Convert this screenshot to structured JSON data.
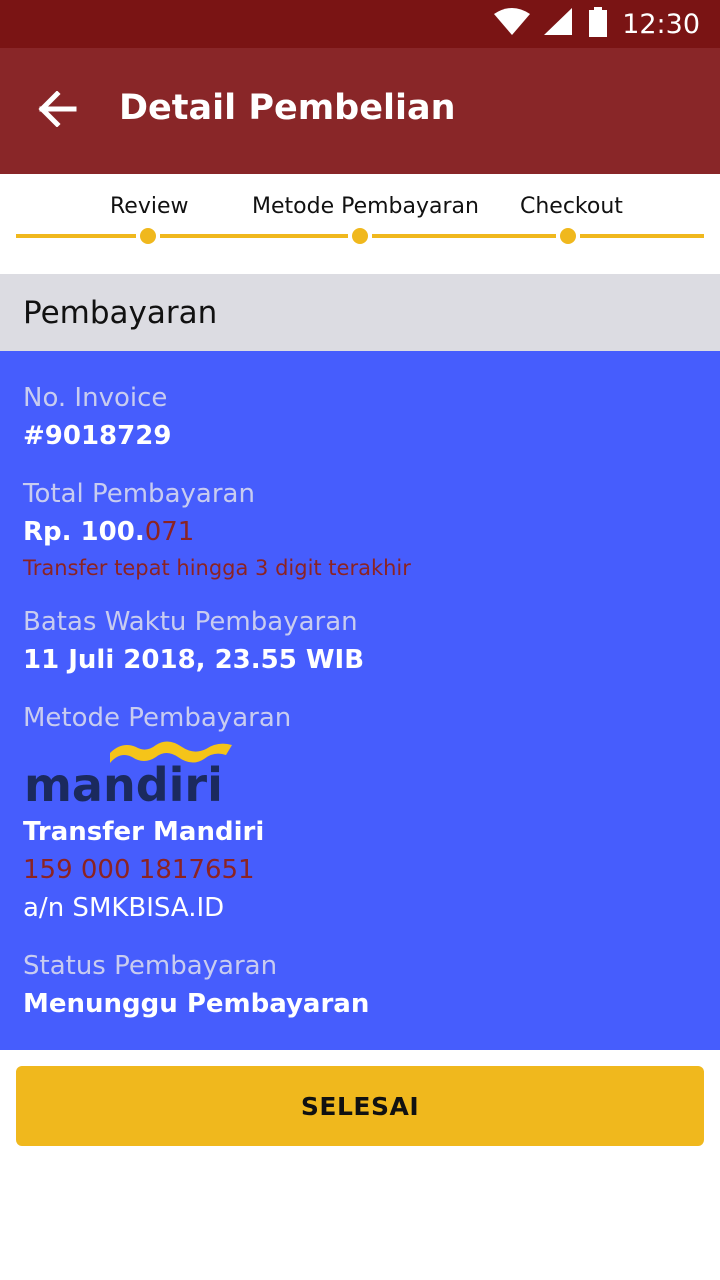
{
  "status_bar": {
    "time": "12:30",
    "icons": [
      "wifi-icon",
      "signal-icon",
      "battery-icon"
    ]
  },
  "app_bar": {
    "title": "Detail Pembelian",
    "back_icon": "arrow-left-icon"
  },
  "stepper": {
    "steps": [
      {
        "label": "Review"
      },
      {
        "label": "Metode Pembayaran"
      },
      {
        "label": "Checkout"
      }
    ]
  },
  "section": {
    "title": "Pembayaran"
  },
  "payment": {
    "invoice_label": "No. Invoice",
    "invoice_value": "#9018729",
    "total_label": "Total Pembayaran",
    "total_value_main": "Rp. 100.",
    "total_value_unique": "071",
    "total_note": "Transfer tepat hingga 3 digit terakhir",
    "deadline_label": "Batas Waktu Pembayaran",
    "deadline_value": "11 Juli 2018, 23.55 WIB",
    "method_label": "Metode Pembayaran",
    "bank_logo_text": "mandiri",
    "bank_method": "Transfer Mandiri",
    "account_number": "159 000 1817651",
    "account_name": "a/n SMKBISA.ID",
    "status_label": "Status Pembayaran",
    "status_value": "Menunggu Pembayaran"
  },
  "actions": {
    "finish_label": "SELESAI"
  },
  "colors": {
    "status_bar": "#7a1414",
    "app_bar": "#892628",
    "accent": "#f0b81d",
    "panel": "#465dfd",
    "highlight_red": "#8b2323"
  }
}
